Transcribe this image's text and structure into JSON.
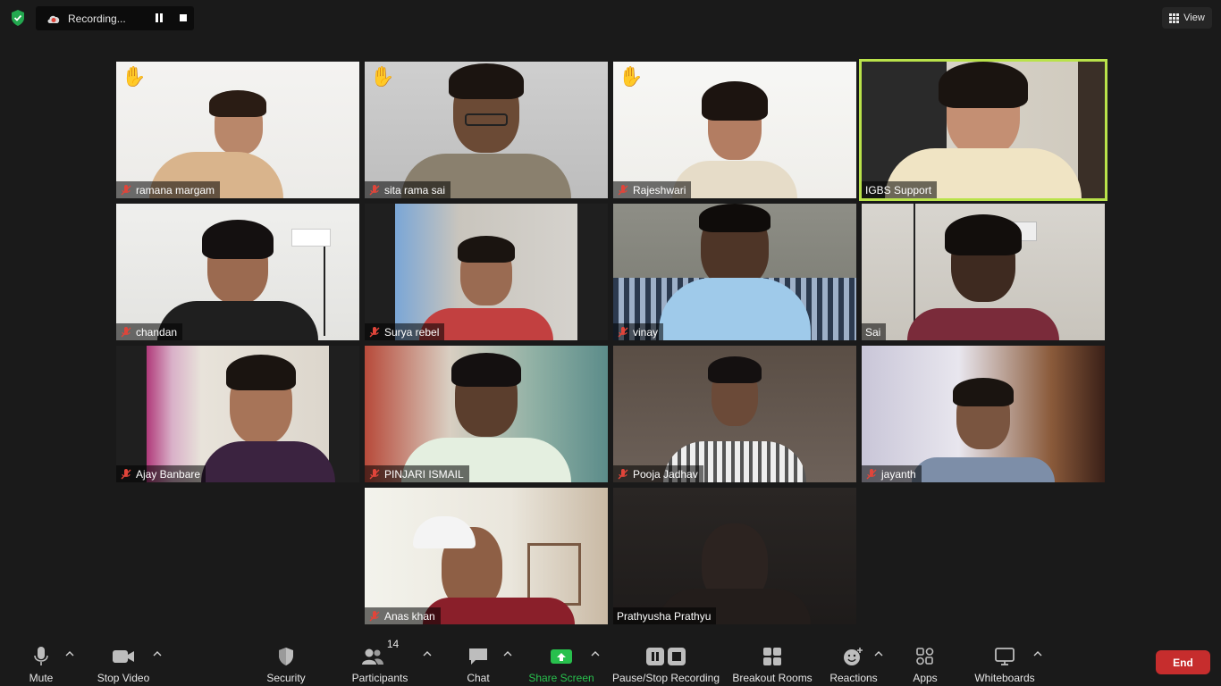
{
  "top_bar": {
    "recording_label": "Recording...",
    "view_label": "View"
  },
  "participants": [
    {
      "name": "ramana margam",
      "muted": true,
      "hand_raised": true
    },
    {
      "name": "sita rama sai",
      "muted": true,
      "hand_raised": true
    },
    {
      "name": "Rajeshwari",
      "muted": true,
      "hand_raised": true
    },
    {
      "name": "IGBS Support",
      "muted": false,
      "hand_raised": false,
      "active_speaker": true
    },
    {
      "name": "chandan",
      "muted": true,
      "hand_raised": false
    },
    {
      "name": "Surya rebel",
      "muted": true,
      "hand_raised": false
    },
    {
      "name": "vinay",
      "muted": true,
      "hand_raised": false
    },
    {
      "name": "Sai",
      "muted": false,
      "hand_raised": false
    },
    {
      "name": "Ajay Banbare",
      "muted": true,
      "hand_raised": false
    },
    {
      "name": "PINJARI ISMAIL",
      "muted": true,
      "hand_raised": false
    },
    {
      "name": "Pooja Jadhav",
      "muted": true,
      "hand_raised": false
    },
    {
      "name": "jayanth",
      "muted": true,
      "hand_raised": false
    },
    {
      "name": "Anas khan",
      "muted": true,
      "hand_raised": false
    },
    {
      "name": "Prathyusha Prathyu",
      "muted": false,
      "hand_raised": false
    }
  ],
  "toolbar": {
    "mute": "Mute",
    "stop_video": "Stop Video",
    "security": "Security",
    "participants": "Participants",
    "participants_count": "14",
    "chat": "Chat",
    "share_screen": "Share Screen",
    "pause_stop_recording": "Pause/Stop Recording",
    "breakout_rooms": "Breakout Rooms",
    "reactions": "Reactions",
    "apps": "Apps",
    "whiteboards": "Whiteboards",
    "end": "End"
  },
  "colors": {
    "active_speaker_border": "#b9e24a",
    "share_green": "#28c04d",
    "end_red": "#c62d2d",
    "muted_red": "#e0453a"
  }
}
